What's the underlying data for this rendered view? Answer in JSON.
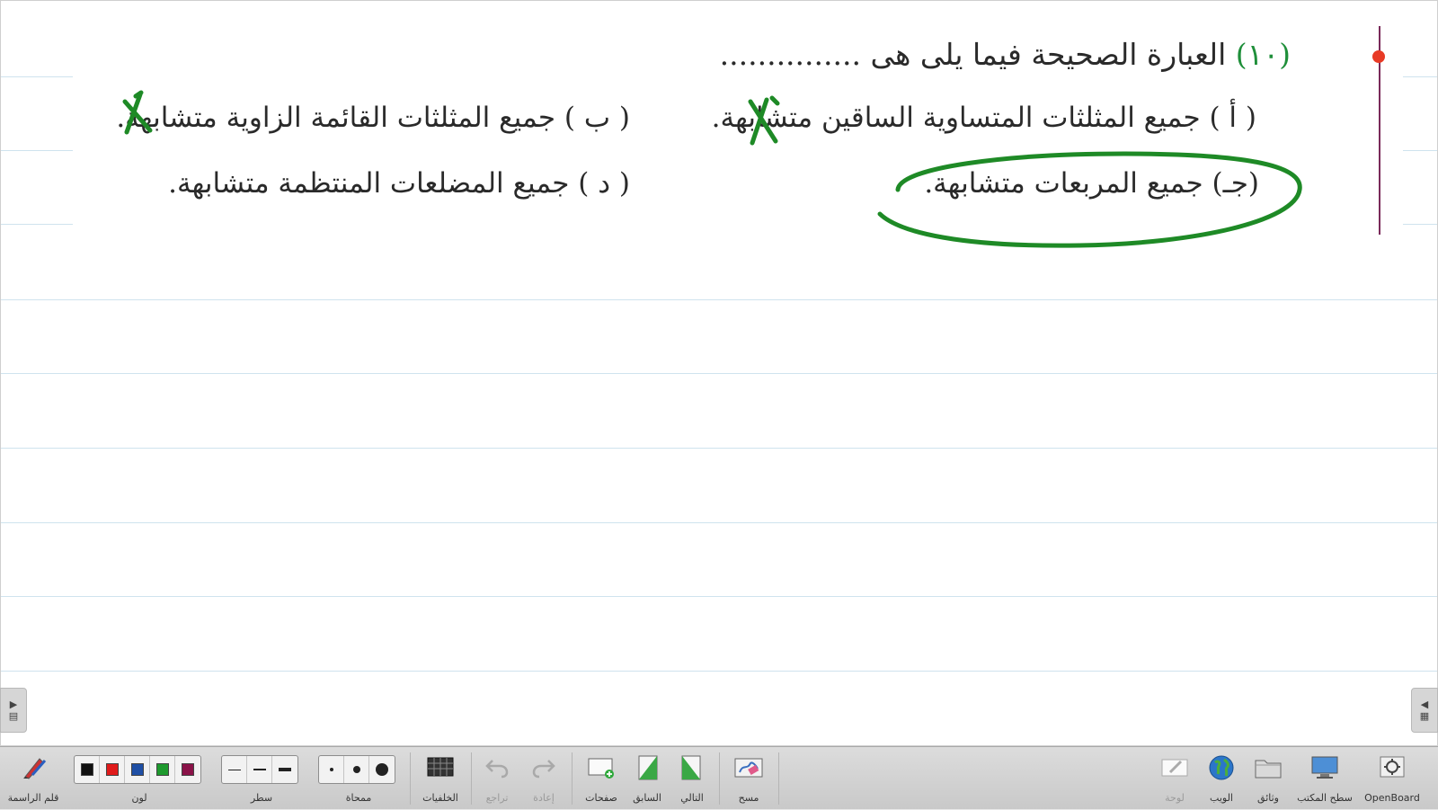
{
  "question": {
    "number": "(١٠)",
    "text": "العبارة الصحيحة فيما يلى هى ..............."
  },
  "options": {
    "a": "( أ ) جميع المثلثات المتساوية الساقين متشابهة.",
    "b": "( ب ) جميع المثلثات القائمة الزاوية متشابهة.",
    "c": "(جـ) جميع المربعات متشابهة.",
    "d": "( د ) جميع المضلعات المنتظمة متشابهة."
  },
  "annotations": {
    "ink_color": "#1e8a26",
    "wrong_marks": [
      "a",
      "b"
    ],
    "circled": "c"
  },
  "toolbar": {
    "pen_label": "قلم الراسمة",
    "color_label": "لون",
    "colors": [
      "#111111",
      "#e01b1b",
      "#1f4fa5",
      "#1e9a2e",
      "#8a1248"
    ],
    "line_label": "سطر",
    "eraser_label": "ممحاة",
    "backgrounds_label": "الخلفيات",
    "undo_label": "تراجع",
    "redo_label": "إعادة",
    "pages_label": "صفحات",
    "previous_label": "السابق",
    "next_label": "التالي",
    "clear_label": "مسح",
    "board_label": "لوحة",
    "web_label": "الويب",
    "documents_label": "وثائق",
    "desktop_label": "سطح المكتب",
    "app_label": "OpenBoard"
  }
}
